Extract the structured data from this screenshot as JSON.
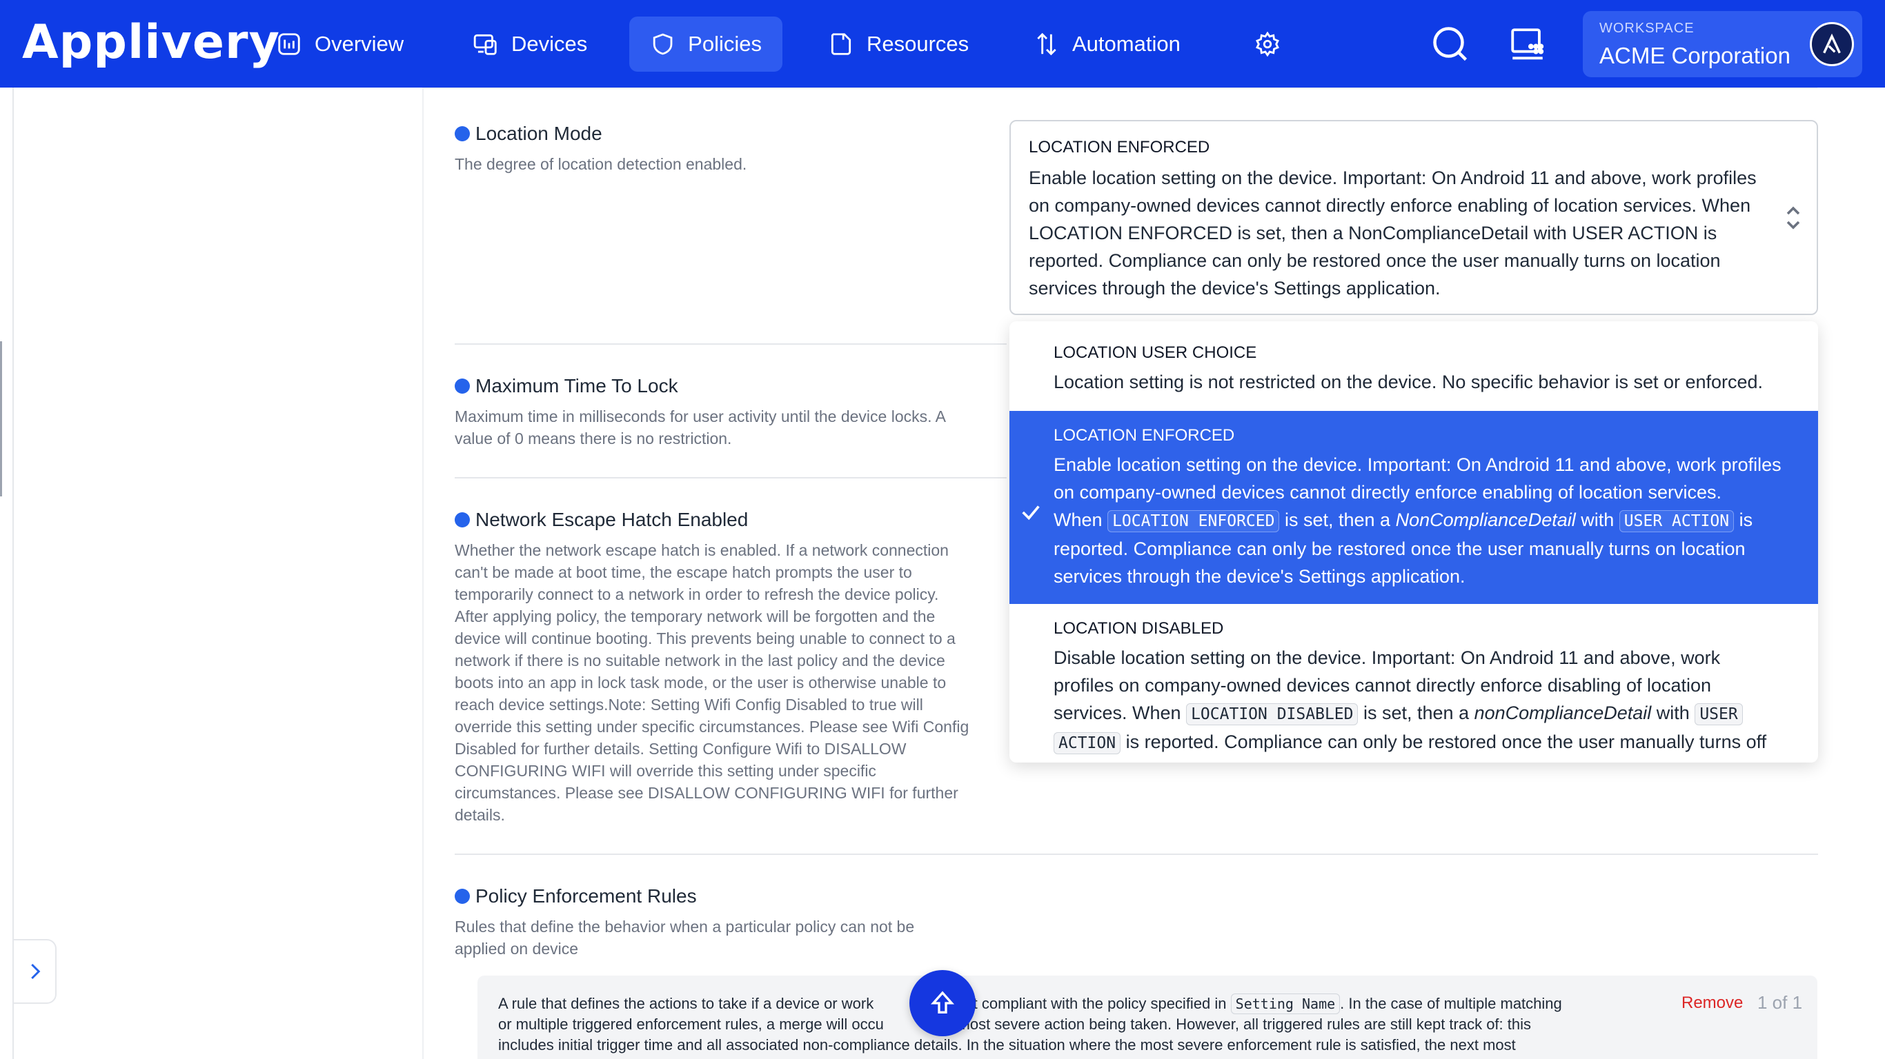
{
  "nav": {
    "logo": "Applivery",
    "items": [
      {
        "label": "Overview"
      },
      {
        "label": "Devices"
      },
      {
        "label": "Policies"
      },
      {
        "label": "Resources"
      },
      {
        "label": "Automation"
      }
    ],
    "workspace_label": "WORKSPACE",
    "workspace_name": "ACME Corporation"
  },
  "sections": {
    "location_mode": {
      "title": "Location Mode",
      "desc": "The degree of location detection enabled."
    },
    "max_time_lock": {
      "title": "Maximum Time To Lock",
      "desc1": "Maximum time in milliseconds for user activity until the device locks. A",
      "desc2": "value of 0 means there is no restriction."
    },
    "network_escape": {
      "title": "Network Escape Hatch Enabled",
      "lines": [
        "Whether the network escape hatch is enabled. If a network connection",
        "can't be made at boot time, the escape hatch prompts the user to",
        "temporarily connect to a network in order to refresh the device policy.",
        "After applying policy, the temporary network will be forgotten and the",
        "device will continue booting. This prevents being unable to connect to a",
        "network if there is no suitable network in the last policy and the device",
        "boots into an app in lock task mode, or the user is otherwise unable to",
        "reach device settings.Note: Setting Wifi Config Disabled to true will",
        "override this setting under specific circumstances. Please see Wifi Config",
        "Disabled for further details. Setting Configure Wifi to DISALLOW",
        "CONFIGURING WIFI will override this setting under specific",
        "circumstances. Please see DISALLOW CONFIGURING WIFI for further",
        "details."
      ]
    },
    "enforcement": {
      "title": "Policy Enforcement Rules",
      "desc1": "Rules that define the behavior when a particular policy can not be",
      "desc2": "applied on device"
    }
  },
  "select": {
    "title": "LOCATION ENFORCED",
    "text": "Enable location setting on the device. Important: On Android 11 and above, work profiles on company-owned devices cannot directly enforce enabling of location services. When LOCATION ENFORCED is set, then a NonComplianceDetail with USER ACTION is reported. Compliance can only be restored once the user manually turns on location services through the device's Settings application."
  },
  "dropdown": {
    "opt1": {
      "title": "LOCATION USER CHOICE",
      "text": "Location setting is not restricted on the device. No specific behavior is set or enforced."
    },
    "opt2": {
      "title": "LOCATION ENFORCED",
      "l1": "Enable location setting on the device. Important: On Android 11 and above, work profiles",
      "l2": "on company-owned devices cannot directly enforce enabling of location services.",
      "l3a": "When",
      "l3code1": "LOCATION ENFORCED",
      "l3b": "is set, then a",
      "l3em": "NonComplianceDetail",
      "l3c": "with",
      "l3code2": "USER ACTION",
      "l3d": "is",
      "l4": "reported. Compliance can only be restored once the user manually turns on location",
      "l5": "services through the device's Settings application."
    },
    "opt3": {
      "title": "LOCATION DISABLED",
      "l1": "Disable location setting on the device. Important: On Android 11 and above, work",
      "l2": "profiles on company-owned devices cannot directly enforce disabling of location",
      "l3a": "services. When",
      "l3code1": "LOCATION DISABLED",
      "l3b": "is set, then a",
      "l3em": "nonComplianceDetail",
      "l3c": "with",
      "l3code2": "USER",
      "l4code": "ACTION",
      "l4": "is reported. Compliance can only be restored once the user manually turns off"
    }
  },
  "rule": {
    "t1a": "A rule that defines the actions to take if a device or work",
    "t1b": "not compliant with the policy specified in",
    "t1code": "Setting Name",
    "t1c": ". In the case of multiple matching",
    "t2a": "or multiple triggered enforcement rules, a merge will occu",
    "t2b": "the most severe action being taken. However, all triggered rules are still kept track of: this",
    "t3": "includes initial trigger time and all associated non-compliance details. In the situation where the most severe enforcement rule is satisfied, the next most",
    "remove": "Remove",
    "pager": "1 of 1"
  }
}
